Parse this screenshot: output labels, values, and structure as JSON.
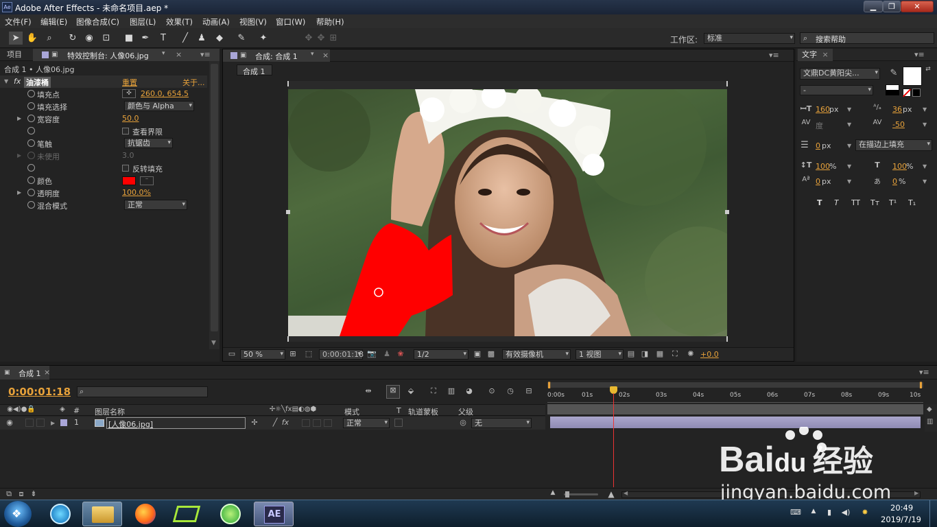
{
  "window": {
    "title": "Adobe After Effects - 未命名项目.aep *",
    "app_icon": "Ae"
  },
  "menu": [
    "文件(F)",
    "编辑(E)",
    "图像合成(C)",
    "图层(L)",
    "效果(T)",
    "动画(A)",
    "视图(V)",
    "窗口(W)",
    "帮助(H)"
  ],
  "toolbar": {
    "workspace_label": "工作区:",
    "workspace_value": "标准",
    "search_placeholder": "搜索帮助"
  },
  "left_panel": {
    "tab_project": "项目",
    "tab_effects": "特效控制台: 人像06.jpg",
    "breadcrumb": "合成 1 • 人像06.jpg",
    "effect": {
      "fx": "fx",
      "name": "油漆桶",
      "reset": "重置",
      "about": "关于..."
    },
    "props": [
      {
        "name": "填充点",
        "value": "260.0, 654.5"
      },
      {
        "name": "填充选择",
        "value": "颜色与 Alpha"
      },
      {
        "name": "宽容度",
        "value": "50.0"
      },
      {
        "name": "",
        "value": "查看界限"
      },
      {
        "name": "笔触",
        "value": "抗锯齿"
      },
      {
        "name": "未使用",
        "value": "3.0"
      },
      {
        "name": "",
        "value": "反转填充"
      },
      {
        "name": "颜色",
        "value": ""
      },
      {
        "name": "透明度",
        "value": "100.0%"
      },
      {
        "name": "混合模式",
        "value": "正常"
      }
    ]
  },
  "comp_panel": {
    "tab": "合成: 合成 1",
    "subtab": "合成 1",
    "footer": {
      "zoom": "50 %",
      "time": "0:00:01:18",
      "resolution": "1/2",
      "camera": "有效摄像机",
      "views": "1 视图",
      "exposure": "+0.0"
    }
  },
  "text_panel": {
    "tab": "文字",
    "font": "文鼎DC黄阳尖...",
    "style": "-",
    "size": "160",
    "size_unit": "px",
    "leading": "36",
    "leading_unit": "px",
    "kerning": "度",
    "tracking": "-50",
    "stroke": "0",
    "stroke_unit": "px",
    "stroke_mode": "在描边上填充",
    "vscale": "100",
    "vscale_unit": "%",
    "hscale": "100",
    "hscale_unit": "%",
    "baseline": "0",
    "baseline_unit": "px",
    "tsume": "0",
    "tsume_unit": "%",
    "styles": [
      "T",
      "T",
      "TT",
      "Tт",
      "T¹",
      "T₁"
    ]
  },
  "timeline": {
    "tab": "合成 1",
    "time": "0:00:01:18",
    "columns": {
      "num": "#",
      "source": "图层名称",
      "mode": "模式",
      "t": "T",
      "trkmat": "轨道蒙板",
      "parent": "父级"
    },
    "ruler": [
      "0:00s",
      "01s",
      "02s",
      "03s",
      "04s",
      "05s",
      "06s",
      "07s",
      "08s",
      "09s",
      "10s"
    ],
    "layer": {
      "index": "1",
      "name": "[人像06.jpg]",
      "mode": "正常",
      "parent": "无"
    },
    "playhead_fraction": 0.176
  },
  "watermark": {
    "brand": "Bai",
    "paw": "du",
    "suffix": "经验",
    "url": "jingyan.baidu.com"
  },
  "taskbar": {
    "time": "20:49",
    "date": "2019/7/19",
    "ae_label": "AE"
  },
  "colors": {
    "accent": "#e8a23a",
    "fill_color": "#ff0000",
    "panel": "#232323"
  }
}
